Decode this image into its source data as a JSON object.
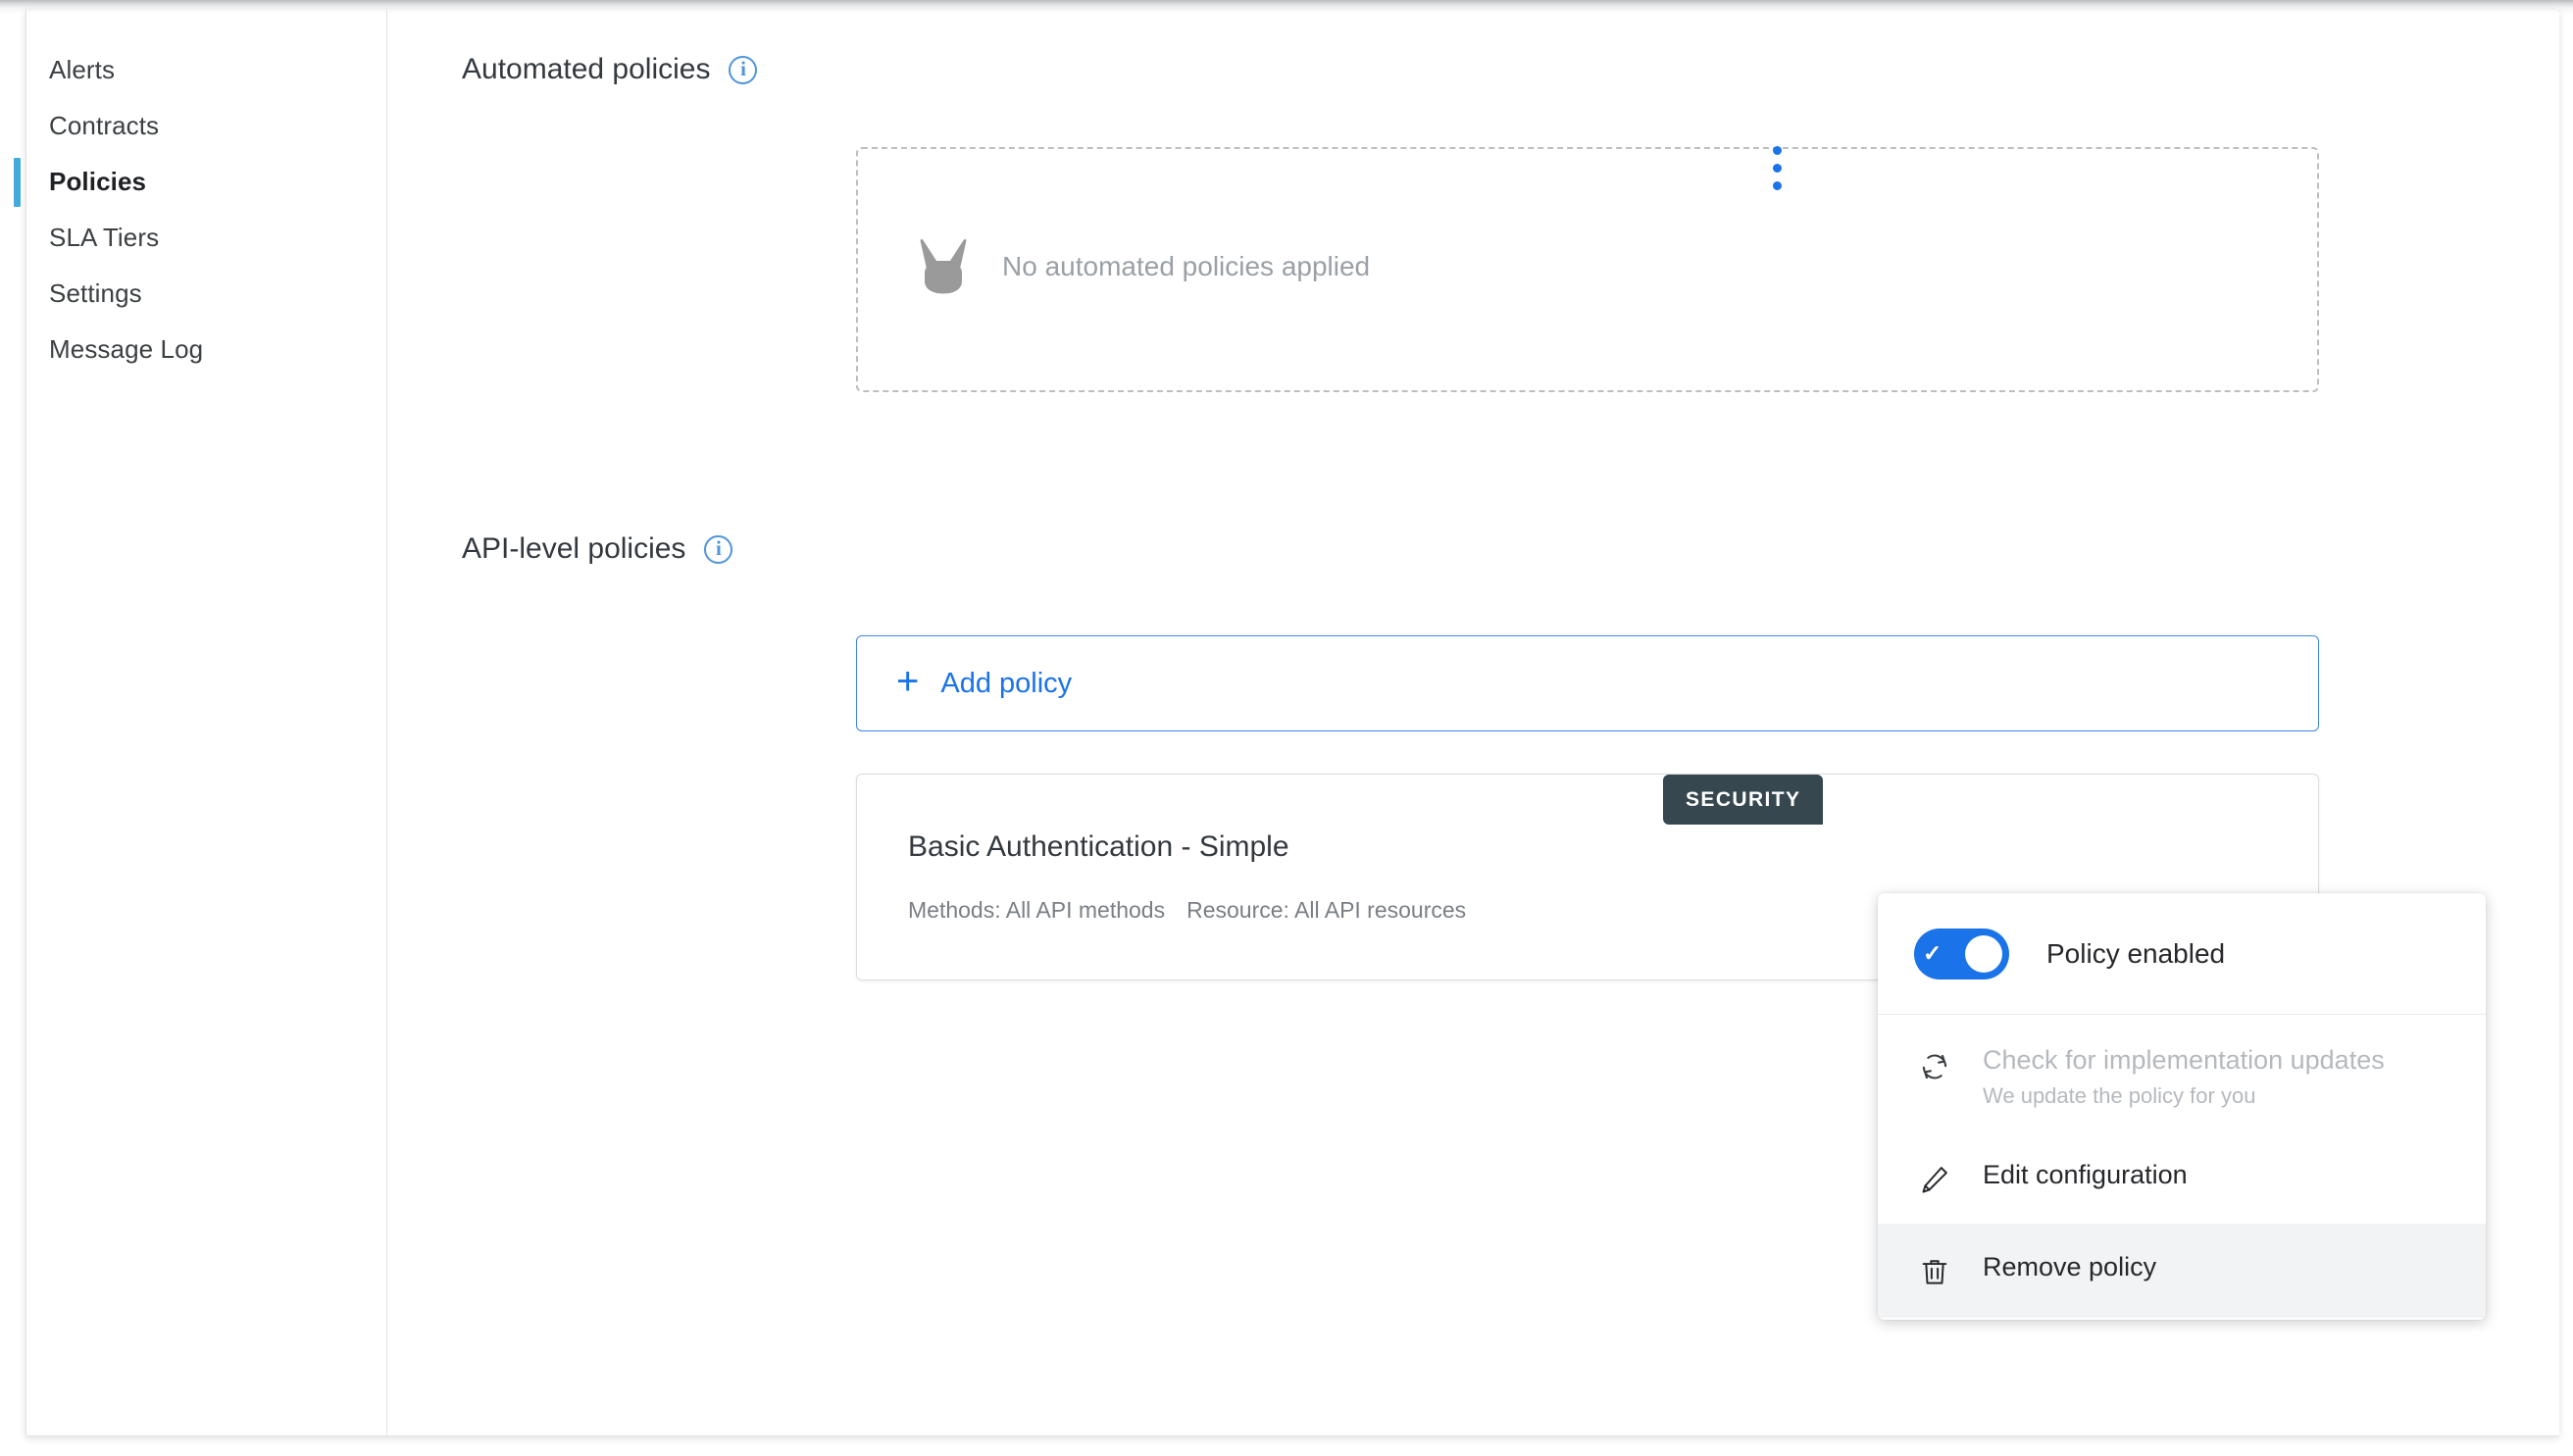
{
  "sidebar": {
    "items": [
      {
        "label": "Alerts",
        "active": false
      },
      {
        "label": "Contracts",
        "active": false
      },
      {
        "label": "Policies",
        "active": true
      },
      {
        "label": "SLA Tiers",
        "active": false
      },
      {
        "label": "Settings",
        "active": false
      },
      {
        "label": "Message Log",
        "active": false
      }
    ]
  },
  "main": {
    "automated_section": {
      "title": "Automated policies",
      "info_icon": "info-circle-icon",
      "empty_state": {
        "icon": "mascot-head-icon",
        "message": "No automated policies applied"
      }
    },
    "api_section": {
      "title": "API-level policies",
      "info_icon": "info-circle-icon",
      "add_button": {
        "icon": "plus-icon",
        "label": "Add policy"
      },
      "policies": [
        {
          "badge": "SECURITY",
          "name": "Basic Authentication - Simple",
          "methods": "Methods: All API methods",
          "resource": "Resource: All API resources",
          "menu_icon": "kebab-menu-icon"
        }
      ]
    }
  },
  "policy_menu": {
    "toggle": {
      "label": "Policy enabled",
      "state": "on",
      "icon": "check-icon"
    },
    "items": [
      {
        "label": "Check for implementation updates",
        "sublabel": "We update the policy for you",
        "icon": "refresh-icon",
        "disabled": true,
        "hovered": false
      },
      {
        "label": "Edit configuration",
        "sublabel": "",
        "icon": "pencil-icon",
        "disabled": false,
        "hovered": false
      },
      {
        "label": "Remove policy",
        "sublabel": "",
        "icon": "trash-icon",
        "disabled": false,
        "hovered": true
      }
    ]
  },
  "colors": {
    "accent_blue": "#1a73e8",
    "active_nav_blue": "#41abdc",
    "badge_dark": "#37474f",
    "info_blue": "#4f95da",
    "muted_text": "#9aa0a6",
    "hover_bg": "#f1f3f4"
  }
}
